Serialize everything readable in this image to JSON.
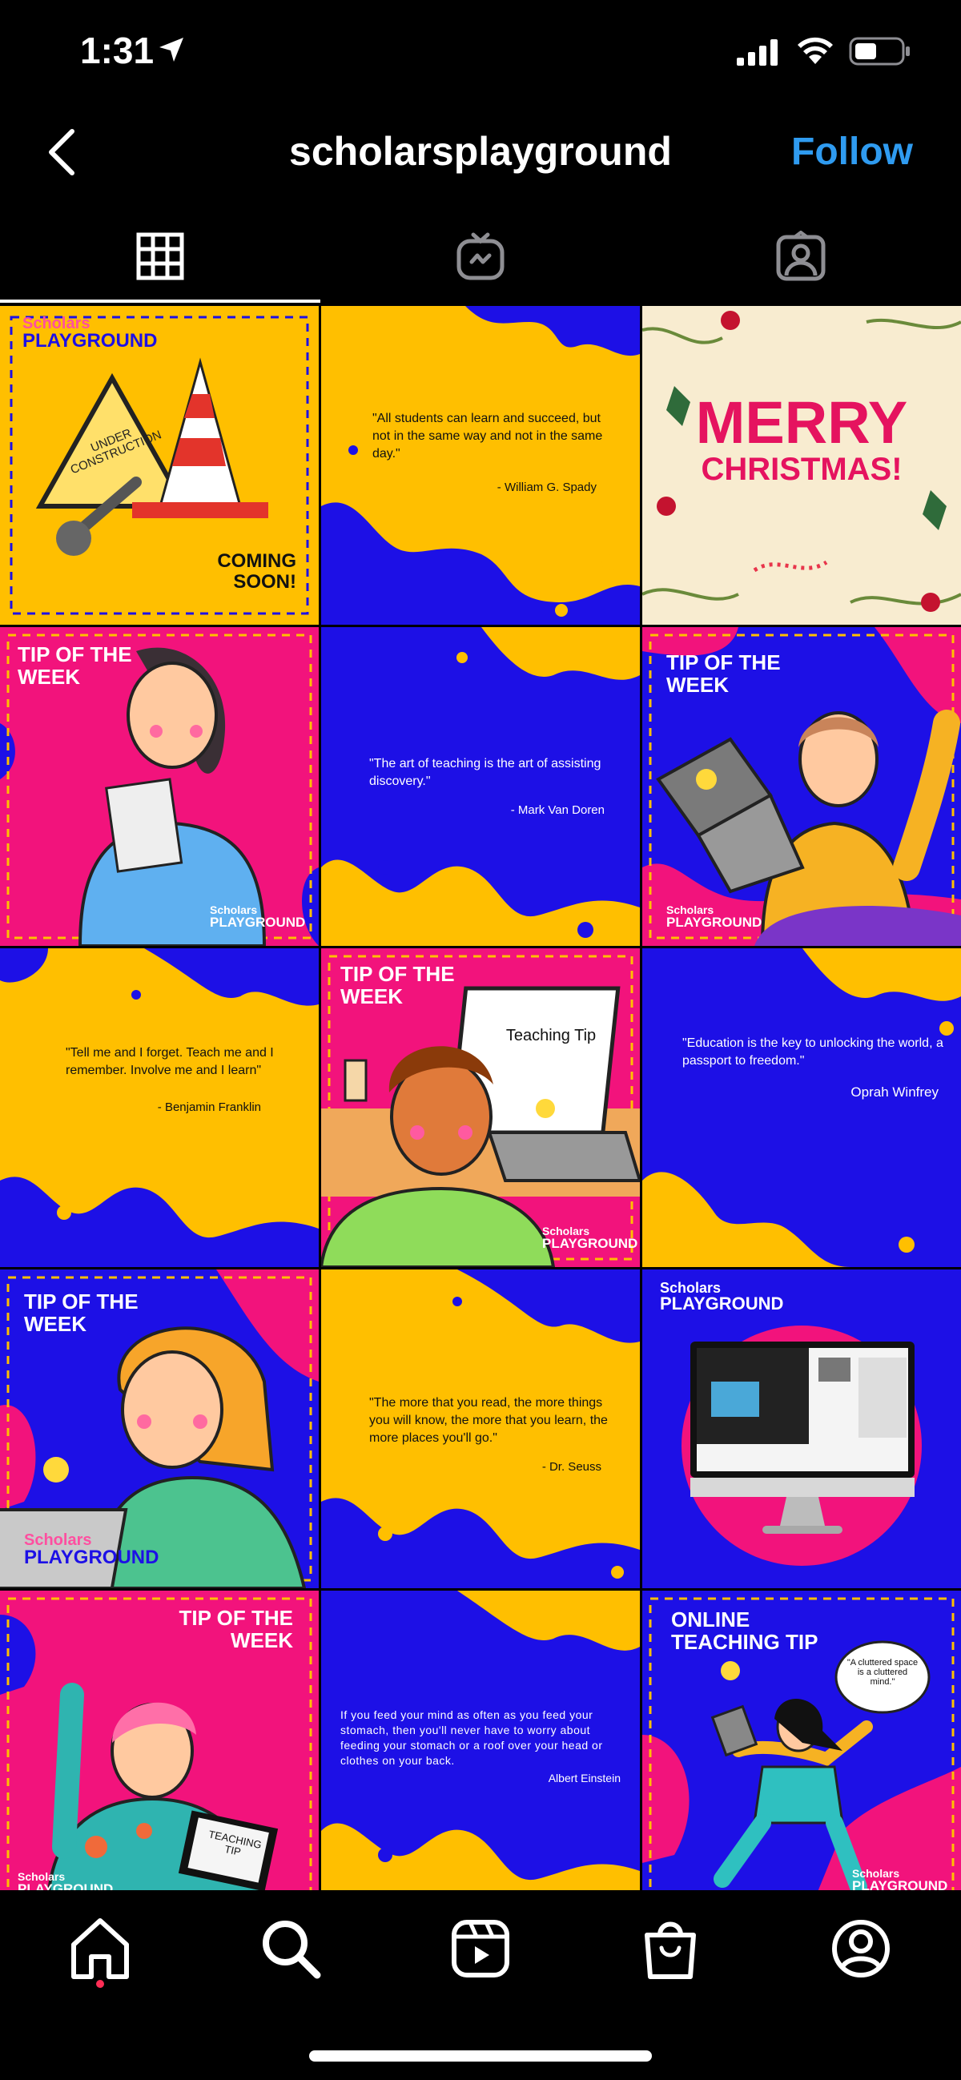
{
  "status": {
    "time": "1:31"
  },
  "header": {
    "username": "scholarsplayground",
    "follow_label": "Follow"
  },
  "tabs": [
    {
      "icon": "grid-icon"
    },
    {
      "icon": "igtv-icon"
    },
    {
      "icon": "tagged-icon"
    }
  ],
  "posts": {
    "p1": {
      "brand_top": "Scholars",
      "brand_bottom": "PLAYGROUND",
      "sign": "UNDER CONSTRUCTION",
      "caption": "COMING SOON!"
    },
    "p2": {
      "quote": "\"All students can learn and succeed, but not in the same way and not in the same day.\"",
      "author": "- William G. Spady"
    },
    "p3": {
      "line1": "MERRY",
      "line2": "CHRISTMAS!"
    },
    "p4": {
      "title": "TIP OF THE WEEK",
      "brand_top": "Scholars",
      "brand_bottom": "PLAYGROUND"
    },
    "p5": {
      "quote": "\"The art of teaching is the art of assisting discovery.\"",
      "author": "- Mark Van Doren"
    },
    "p6": {
      "title": "TIP OF THE WEEK",
      "brand_top": "Scholars",
      "brand_bottom": "PLAYGROUND"
    },
    "p7": {
      "quote": "\"Tell me and I forget. Teach me and I remember. Involve me and I learn\"",
      "author": "- Benjamin Franklin"
    },
    "p8": {
      "title": "TIP OF THE WEEK",
      "screen_text": "Teaching Tip",
      "brand_top": "Scholars",
      "brand_bottom": "PLAYGROUND"
    },
    "p9": {
      "quote": "\"Education is the key to unlocking the world, a passport to freedom.\"",
      "author": "Oprah Winfrey"
    },
    "p10": {
      "title": "TIP OF THE WEEK",
      "brand_top": "Scholars",
      "brand_bottom": "PLAYGROUND"
    },
    "p11": {
      "quote": "\"The more that you read, the more things you will know, the more that you learn, the more places you'll go.\"",
      "author": "- Dr. Seuss"
    },
    "p12": {
      "brand_top": "Scholars",
      "brand_bottom": "PLAYGROUND"
    },
    "p13": {
      "title": "TIP OF THE WEEK",
      "laptop_text": "TEACHING TIP",
      "brand_top": "Scholars",
      "brand_bottom": "PLAYGROUND"
    },
    "p14": {
      "quote": "If you feed your mind as often as you feed your stomach, then you'll never have to worry about feeding your stomach or a roof over your head or clothes on your back.",
      "author": "Albert Einstein"
    },
    "p15": {
      "title": "ONLINE TEACHING TIP",
      "bubble": "\"A cluttered space is a cluttered mind.\"",
      "brand_top": "Scholars",
      "brand_bottom": "PLAYGROUND"
    }
  },
  "bottom_nav": [
    {
      "icon": "home-icon"
    },
    {
      "icon": "search-icon"
    },
    {
      "icon": "reels-icon"
    },
    {
      "icon": "shop-icon"
    },
    {
      "icon": "profile-icon"
    }
  ],
  "colors": {
    "yellow": "#ffbf00",
    "blue": "#1d10e6",
    "pink": "#f2137c",
    "accent": "#2f9bf0"
  }
}
